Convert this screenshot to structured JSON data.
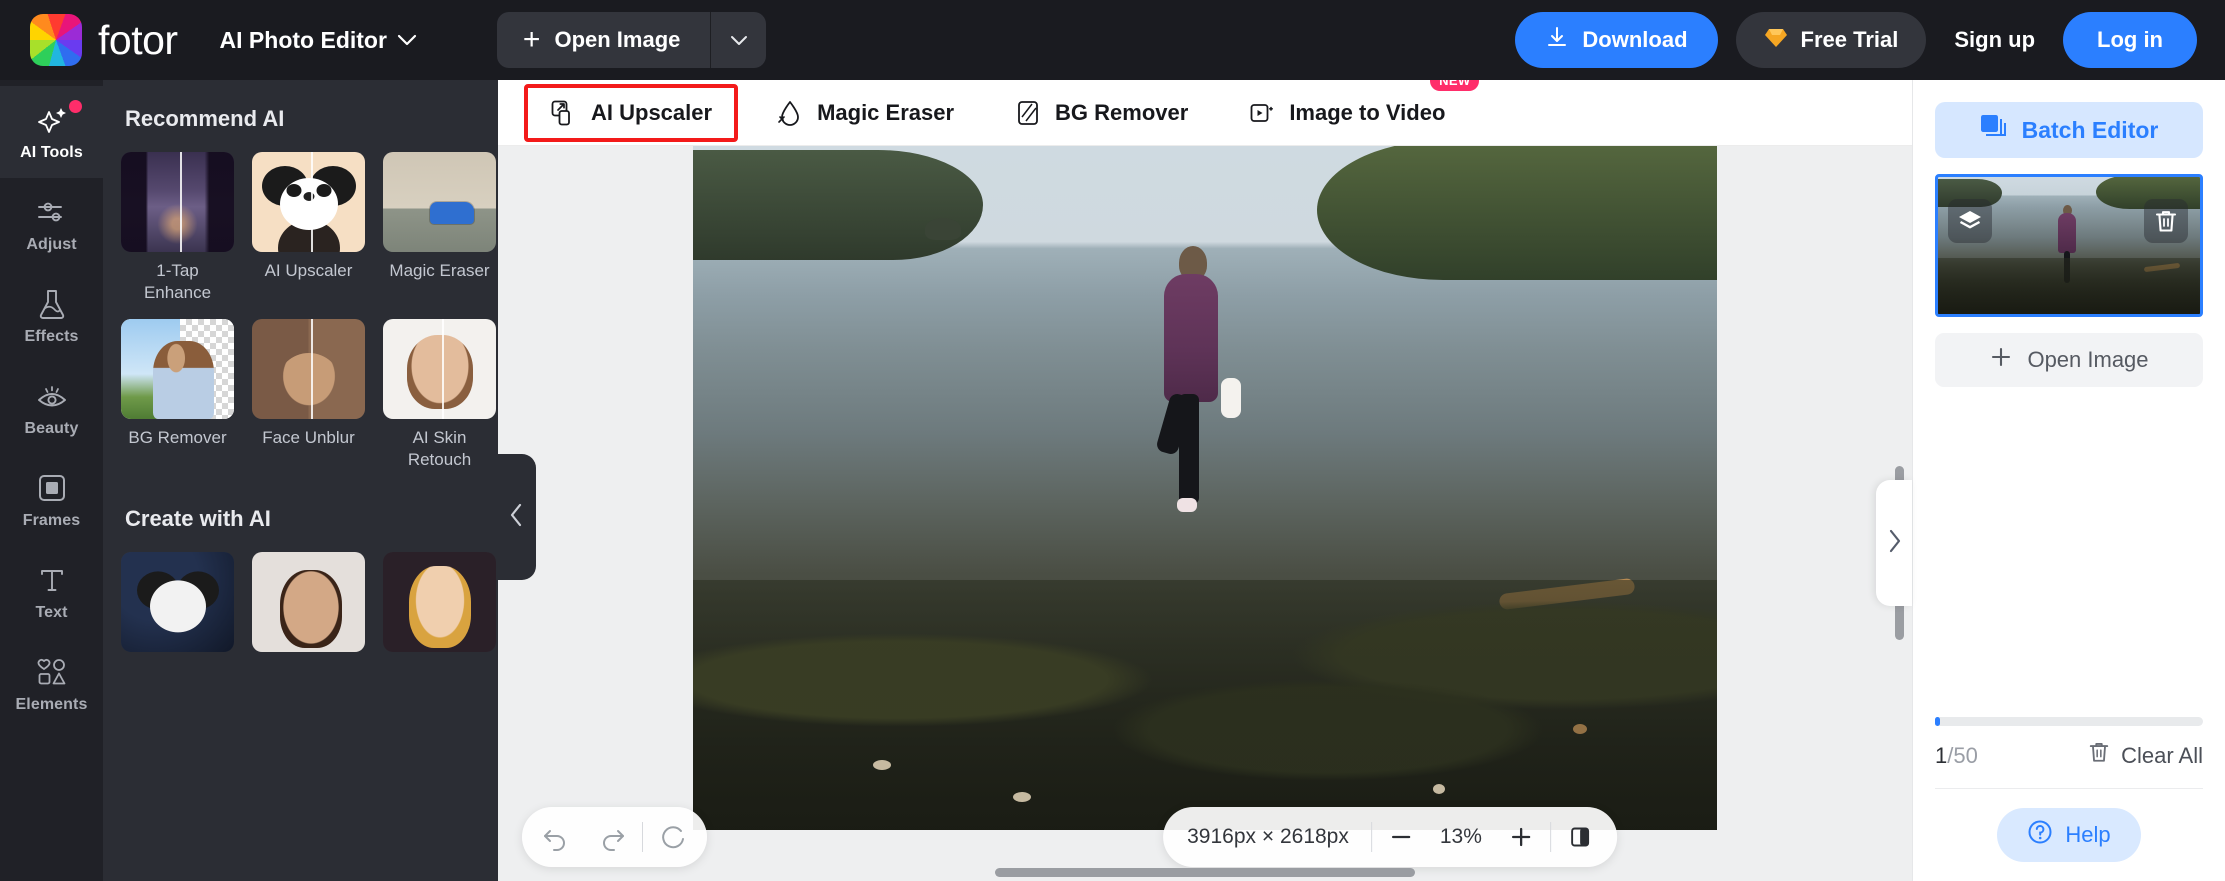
{
  "topbar": {
    "brand_name": "fotor",
    "app_switcher_label": "AI Photo Editor",
    "open_image_label": "Open Image",
    "download_label": "Download",
    "free_trial_label": "Free Trial",
    "sign_up_label": "Sign up",
    "log_in_label": "Log in"
  },
  "rail": {
    "items": [
      {
        "label": "AI Tools",
        "icon": "sparkle-icon",
        "active": true,
        "has_dot": true
      },
      {
        "label": "Adjust",
        "icon": "sliders-icon",
        "active": false,
        "has_dot": false
      },
      {
        "label": "Effects",
        "icon": "flask-icon",
        "active": false,
        "has_dot": false
      },
      {
        "label": "Beauty",
        "icon": "eye-icon",
        "active": false,
        "has_dot": false
      },
      {
        "label": "Frames",
        "icon": "frame-icon",
        "active": false,
        "has_dot": false
      },
      {
        "label": "Text",
        "icon": "text-t-icon",
        "active": false,
        "has_dot": false
      },
      {
        "label": "Elements",
        "icon": "shapes-icon",
        "active": false,
        "has_dot": false
      }
    ]
  },
  "toolpanel": {
    "recommend_title": "Recommend AI",
    "recommend_tiles": [
      {
        "label": "1-Tap Enhance",
        "art": "art-street"
      },
      {
        "label": "AI Upscaler",
        "art": "art-panda"
      },
      {
        "label": "Magic Eraser",
        "art": "art-car"
      },
      {
        "label": "BG Remover",
        "art": "art-bgremover"
      },
      {
        "label": "Face Unblur",
        "art": "art-faceunblur"
      },
      {
        "label": "AI Skin Retouch",
        "art": "art-skinretouch"
      }
    ],
    "create_title": "Create with AI",
    "create_tiles": [
      {
        "label": "",
        "art": "art-astropanda"
      },
      {
        "label": "",
        "art": "art-manface"
      },
      {
        "label": "",
        "art": "art-womanface"
      }
    ],
    "collapse_icon": "chevron-left-icon"
  },
  "tabs": [
    {
      "label": "AI Upscaler",
      "icon": "upscale-icon",
      "selected": true,
      "badge": ""
    },
    {
      "label": "Magic Eraser",
      "icon": "eraser-icon",
      "selected": false,
      "badge": ""
    },
    {
      "label": "BG Remover",
      "icon": "bg-remove-icon",
      "selected": false,
      "badge": ""
    },
    {
      "label": "Image to Video",
      "icon": "video-icon",
      "selected": false,
      "badge": "NEW"
    }
  ],
  "canvas": {
    "undo_icon": "undo-icon",
    "redo_icon": "redo-icon",
    "reset_icon": "reset-icon",
    "dimensions": "3916px × 2618px",
    "zoom_minus": "−",
    "zoom_level": "13%",
    "zoom_plus": "+",
    "compare_icon": "compare-icon",
    "expand_icon": "chevron-right-icon"
  },
  "rightpanel": {
    "batch_editor_label": "Batch Editor",
    "batch_editor_icon": "layers-stack-icon",
    "thumb_layers_icon": "layers-icon",
    "thumb_delete_icon": "trash-icon",
    "open_image_label": "Open Image",
    "count_current": "1",
    "count_separator": "/",
    "count_total": "50",
    "clear_all_label": "Clear All",
    "clear_all_icon": "trash-icon",
    "help_label": "Help",
    "help_icon": "question-circle-icon",
    "progress_percent": 2
  },
  "colors": {
    "accent_blue": "#2b7fff",
    "highlight_red": "#f31a1a",
    "badge_pink": "#ff2d6a",
    "dark_bg": "#1a1b20",
    "panel_bg": "#2b2d34",
    "rail_bg": "#202127"
  }
}
